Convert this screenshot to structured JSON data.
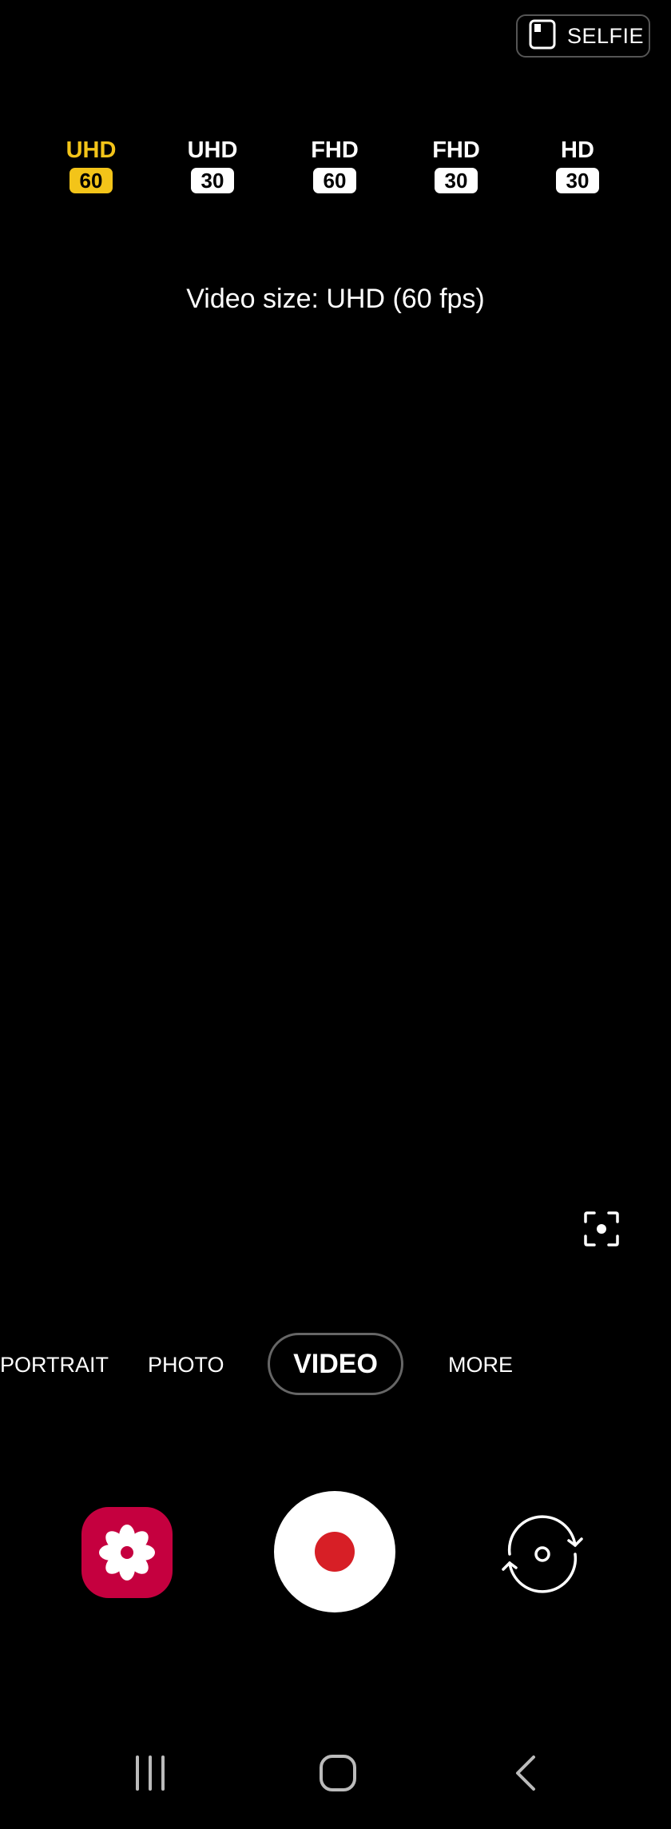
{
  "top": {
    "selfie_label": "SELFIE"
  },
  "resolutions": [
    {
      "name": "UHD",
      "fps": "60",
      "selected": true
    },
    {
      "name": "UHD",
      "fps": "30",
      "selected": false
    },
    {
      "name": "FHD",
      "fps": "60",
      "selected": false
    },
    {
      "name": "FHD",
      "fps": "30",
      "selected": false
    },
    {
      "name": "HD",
      "fps": "30",
      "selected": false
    }
  ],
  "info": {
    "video_size": "Video size: UHD (60 fps)"
  },
  "modes": {
    "portrait": "PORTRAIT",
    "photo": "PHOTO",
    "video": "VIDEO",
    "more": "MORE"
  },
  "colors": {
    "accent": "#f3c419",
    "record": "#d71f26",
    "gallery": "#c5003f"
  },
  "icons": {
    "selfie": "selfie-screen-icon",
    "focus": "focus-target-icon",
    "gallery": "gallery-flower-icon",
    "record": "record-icon",
    "switch": "switch-camera-icon",
    "recents": "recents-icon",
    "home": "home-icon",
    "back": "back-icon"
  }
}
